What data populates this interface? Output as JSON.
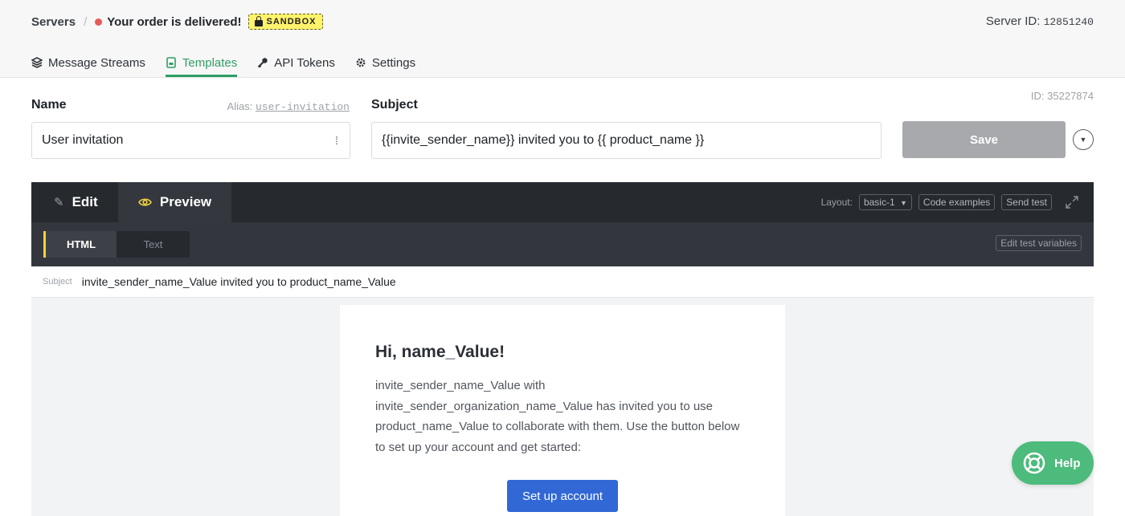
{
  "breadcrumb": {
    "root": "Servers",
    "separator": "/",
    "server_name": "Your order is delivered!",
    "badge": "SANDBOX"
  },
  "server_id": {
    "label": "Server ID:",
    "value": "12851240"
  },
  "nav": {
    "tabs": [
      {
        "label": "Message Streams",
        "icon": "streams-icon"
      },
      {
        "label": "Templates",
        "icon": "template-icon",
        "active": true
      },
      {
        "label": "API Tokens",
        "icon": "key-icon"
      },
      {
        "label": "Settings",
        "icon": "gear-icon"
      }
    ]
  },
  "form": {
    "name_label": "Name",
    "alias_label": "Alias:",
    "alias_value": "user-invitation",
    "name_value": "User invitation",
    "subject_label": "Subject",
    "subject_value": "{{invite_sender_name}} invited you to {{ product_name }}",
    "template_id": "ID: 35227874",
    "save_label": "Save"
  },
  "editor": {
    "tabs": {
      "edit": "Edit",
      "preview": "Preview"
    },
    "layout_label": "Layout:",
    "layout_value": "basic-1",
    "code_examples": "Code examples",
    "send_test": "Send test",
    "format_tabs": {
      "html": "HTML",
      "text": "Text"
    },
    "edit_test_variables": "Edit test variables",
    "subject_label": "Subject",
    "subject_value": "invite_sender_name_Value invited you to product_name_Value"
  },
  "email_preview": {
    "heading": "Hi, name_Value!",
    "body": "invite_sender_name_Value with invite_sender_organization_name_Value has invited you to use product_name_Value to collaborate with them. Use the button below to set up your account and get started:",
    "button": "Set up account"
  },
  "help": {
    "label": "Help"
  },
  "colors": {
    "accent": "#2f9e63",
    "status_dot": "#e85a57",
    "sandbox": "#fff36b",
    "cta": "#3168d6",
    "help": "#4dbb7c"
  }
}
